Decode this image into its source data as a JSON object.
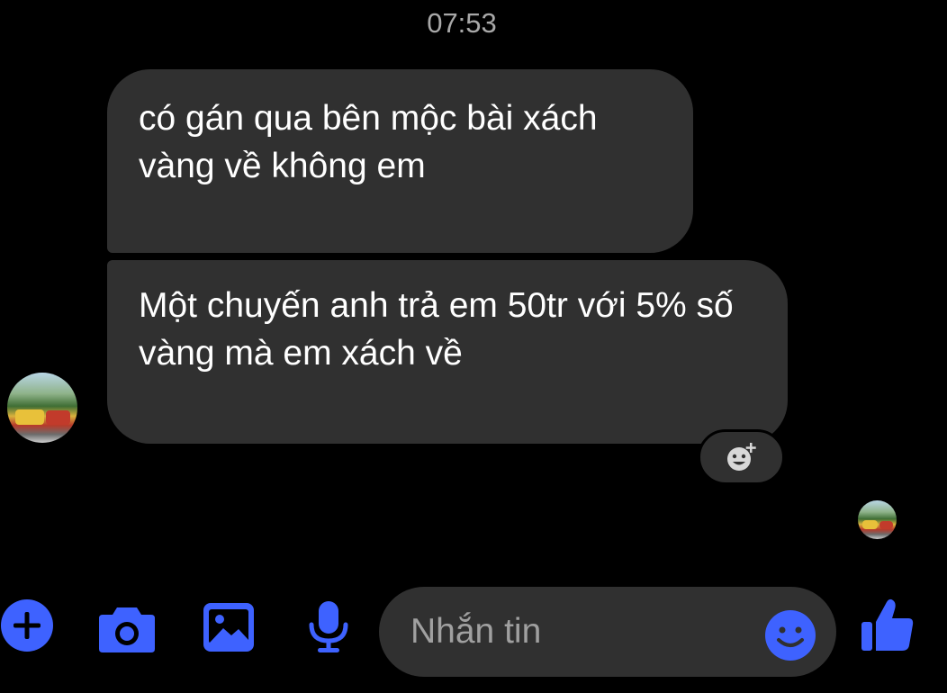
{
  "conversation": {
    "timestamp": "07:53",
    "messages": [
      {
        "text": "có gán qua bên mộc bài xách vàng về không em"
      },
      {
        "text": "Một chuyến anh trả em 50tr với 5% số vàng mà em xách về"
      }
    ]
  },
  "composer": {
    "placeholder": "Nhắn tin",
    "icons": [
      "plus-icon",
      "camera-icon",
      "image-icon",
      "microphone-icon",
      "emoji-icon",
      "thumbs-up-icon"
    ]
  },
  "reaction": {
    "icon": "add-reaction-icon"
  },
  "colors": {
    "accent": "#3e62ff",
    "bubble": "#303030",
    "background": "#000000",
    "timestamp": "#a8a8a8"
  }
}
